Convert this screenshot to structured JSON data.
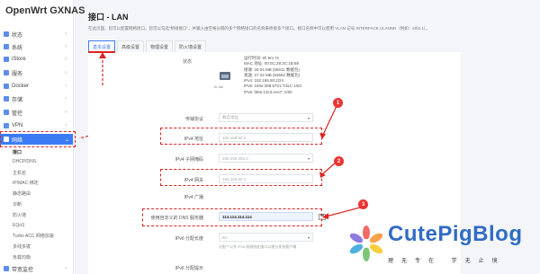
{
  "brand": "OpenWrt GXNAS",
  "sidebar": {
    "items": [
      {
        "label": "状态"
      },
      {
        "label": "系统"
      },
      {
        "label": "iStore"
      },
      {
        "label": "服务"
      },
      {
        "label": "Docker"
      },
      {
        "label": "存储"
      },
      {
        "label": "管控"
      },
      {
        "label": "VPN"
      },
      {
        "label": "网络"
      }
    ],
    "subitems": [
      "接口",
      "DHCP/DNS",
      "主机名",
      "IP/MAC 绑定",
      "静态路由",
      "诊断",
      "防火墙",
      "EQoS",
      "Turbo ACC 网络加速",
      "多线多拨",
      "负载均衡"
    ],
    "bottom_item": "带宽监控"
  },
  "header": {
    "title": "接口 - LAN",
    "description": "在此页面，您可以配置网络接口。您可以勾选“桥接接口”，并输入由空格分隔的多个网络接口的名称来桥接多个接口。接口名称中可以使用 VLAN 记号 INTERFACE.VLANNR（例如：eth0.1）。"
  },
  "tabs": [
    "基本设置",
    "高级设置",
    "物理设置",
    "防火墙设置"
  ],
  "status": {
    "label": "状态",
    "icon_label": "br-lan",
    "lines": [
      "运行时间: 6h 9m 7s",
      "MAC 地址: 00:0C:29:2C:1B:89",
      "接收: 29.04 MB (55011 数据包)",
      "发送: 27.22 MB (53652 数据包)",
      "IPv4: 192.168.50.2/24",
      "IPv6: 240e:388:8721:7d14::1/62",
      "IPv6: fd6e:13c3:ece7::1/60"
    ]
  },
  "form": {
    "protocol": {
      "label": "传输协议",
      "value": "静态地址"
    },
    "ipv4_address": {
      "label": "IPv4 地址",
      "value": "192.168.50.2"
    },
    "ipv4_netmask": {
      "label": "IPv4 子网掩码",
      "value": "255.255.255.0"
    },
    "ipv4_gateway": {
      "label": "IPv4 网关",
      "value": "192.168.50.1"
    },
    "ipv4_broadcast": {
      "label": "IPv4 广播"
    },
    "dns": {
      "label": "使用自定义的 DNS 服务器",
      "value": "114.114.114.114"
    },
    "ipv6_assign": {
      "label": "IPv6 分配长度",
      "value": "60",
      "hint": "分配个公共 IPv6 前缀给此接口以便分发给客户端"
    },
    "ipv6_hint": {
      "label": "IPv6 分配提示"
    }
  },
  "annotations": [
    "1",
    "2",
    "3"
  ],
  "watermark": {
    "title": "CutePigBlog",
    "subtitle": "理无专在 学无止境"
  }
}
